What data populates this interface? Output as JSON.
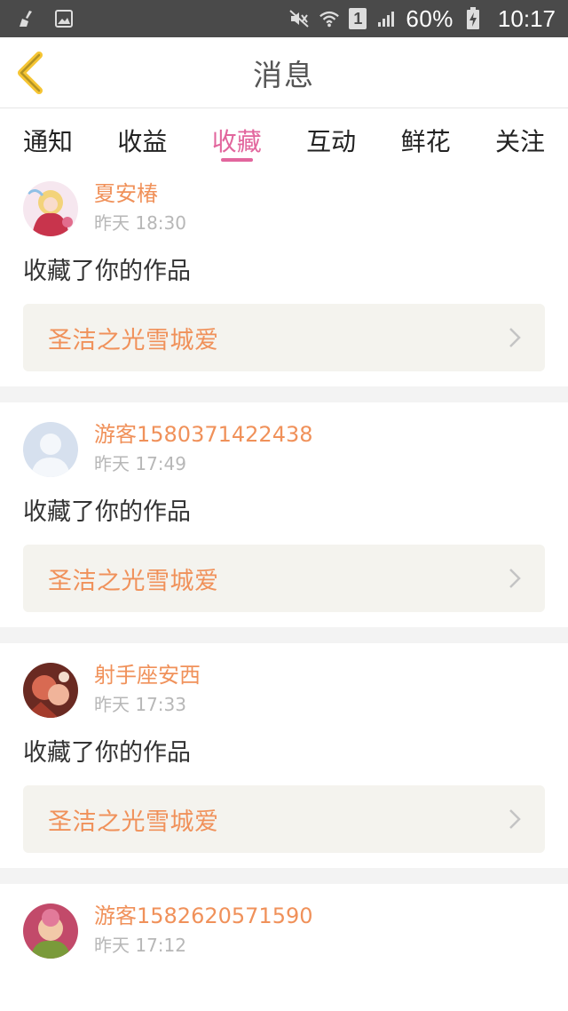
{
  "status_bar": {
    "battery": "60%",
    "time": "10:17",
    "sim_label": "1",
    "icons": [
      "broom-icon",
      "image-icon",
      "mute-icon",
      "wifi-icon",
      "sim-icon",
      "signal-icon",
      "battery-icon"
    ]
  },
  "header": {
    "title": "消息",
    "back_icon": "chevron-left-icon"
  },
  "tabs": [
    {
      "label": "通知",
      "active": false
    },
    {
      "label": "收益",
      "active": false
    },
    {
      "label": "收藏",
      "active": true
    },
    {
      "label": "互动",
      "active": false
    },
    {
      "label": "鲜花",
      "active": false
    },
    {
      "label": "关注",
      "active": false
    }
  ],
  "colors": {
    "accent_pink": "#e2669d",
    "accent_orange": "#f0915a",
    "status_bar_bg": "#4a4a4a",
    "work_box_bg": "#f4f3ee"
  },
  "messages": [
    {
      "username": "夏安椿",
      "time": "昨天 18:30",
      "action": "收藏了你的作品",
      "work_title": "圣洁之光雪城爱"
    },
    {
      "username": "游客1580371422438",
      "time": "昨天 17:49",
      "action": "收藏了你的作品",
      "work_title": "圣洁之光雪城爱"
    },
    {
      "username": "射手座安西",
      "time": "昨天 17:33",
      "action": "收藏了你的作品",
      "work_title": "圣洁之光雪城爱"
    },
    {
      "username": "游客1582620571590",
      "time": "昨天 17:12"
    }
  ]
}
